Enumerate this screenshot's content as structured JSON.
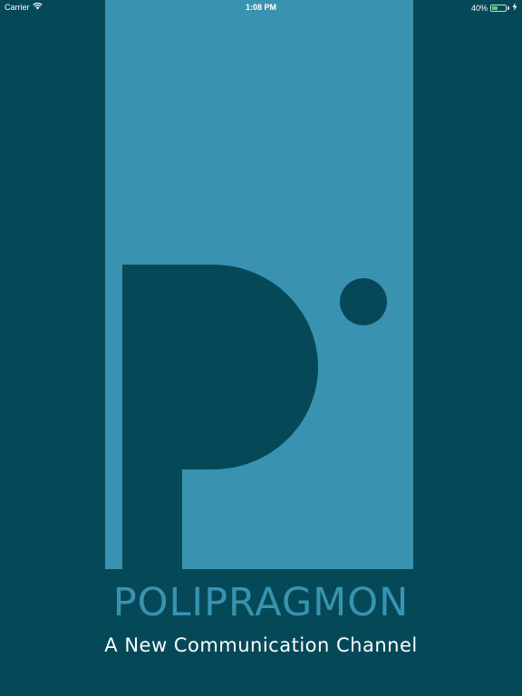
{
  "status_bar": {
    "carrier": "Carrier",
    "time": "1:08 PM",
    "battery_percent": "40%",
    "battery_level": 0.4,
    "icons": [
      "wifi-icon",
      "battery-icon",
      "charging-icon"
    ]
  },
  "splash": {
    "brand_name": "POLIPRAGMON",
    "tagline": "A New Communication Channel",
    "colors": {
      "background": "#054959",
      "panel": "#3993b0",
      "text": "#ffffff"
    }
  }
}
